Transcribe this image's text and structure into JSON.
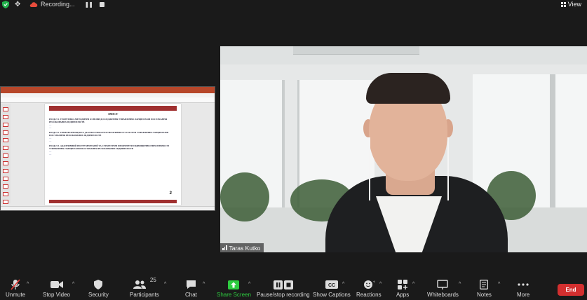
{
  "top_bar": {
    "recording_label": "Recording...",
    "view_label": "View"
  },
  "shared_screen": {
    "slide_heading": "ЗМІСТ",
    "sections": [
      {
        "title": "РОЗДІЛ 1. ТЕОРЕТИКО-МЕТОДИЧНІ ОСНОВИ ДОСЛІДЖЕННЯ УПРАВЛІННЯ ЛАНЦЮГАМИ ПОСТАЧАННЯ РЕЛОКОВАНИХ ПІДПРИЄМСТВ"
      },
      {
        "title": "РОЗДІЛ 2. ТРАНСФОРМАЦІЯ ТА ДІАГНОСТИКА РЕЗУЛЬТАТИВНОСТІ СИСТЕМ УПРАВЛІННЯ ЛАНЦЮГАМИ ПОСТАЧАННЯ РЕЛОКОВАНИХ ПІДПРИЄМСТВ"
      },
      {
        "title": "РОЗДІЛ 3. АДАПТИВНИЙ ІНСТРУМЕНТАРІЙ ТА СТРАТЕГІЧНІ ПРІОРИТЕТИ ПІДВИЩЕННЯ ЕФЕКТИВНОСТІ УПРАВЛІННЯ ЛАНЦЮГАМИ ПОСТАЧАННЯ РЕЛОКОВАНИХ ПІДПРИЄМСТВ"
      }
    ],
    "page_number": "2"
  },
  "video": {
    "participant_name": "Taras Kutko"
  },
  "toolbar": {
    "items": [
      {
        "label": "Unmute",
        "icon": "mic-muted-icon"
      },
      {
        "label": "Stop Video",
        "icon": "video-camera-icon"
      },
      {
        "label": "Security",
        "icon": "shield-icon"
      },
      {
        "label": "Participants",
        "icon": "participants-icon",
        "count": "25"
      },
      {
        "label": "Chat",
        "icon": "chat-bubble-icon"
      },
      {
        "label": "Share Screen",
        "icon": "share-screen-icon"
      },
      {
        "label": "Pause/stop recording",
        "icon": "pause-stop-recording-icon"
      },
      {
        "label": "Show Captions",
        "icon": "captions-icon"
      },
      {
        "label": "Reactions",
        "icon": "reactions-icon"
      },
      {
        "label": "Apps",
        "icon": "apps-icon"
      },
      {
        "label": "Whiteboards",
        "icon": "whiteboard-icon"
      },
      {
        "label": "Notes",
        "icon": "notes-icon"
      },
      {
        "label": "More",
        "icon": "more-dots-icon"
      }
    ],
    "end_label": "End"
  },
  "colors": {
    "share_accent": "#2ecc40",
    "end_button": "#d32f2f",
    "background": "#1a1a1a"
  }
}
